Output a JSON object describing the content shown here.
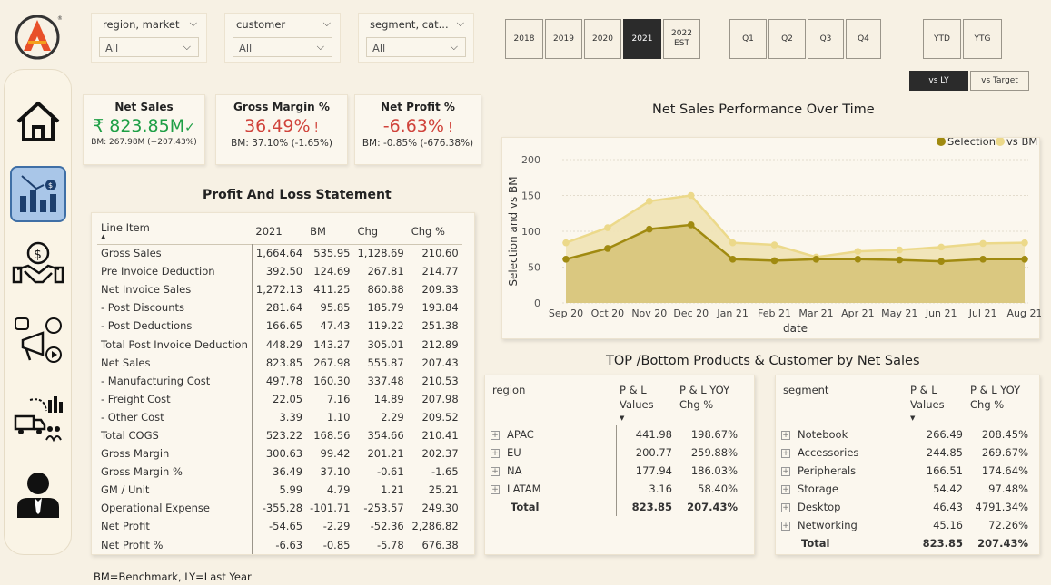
{
  "filters": [
    {
      "label": "region, market",
      "value": "All"
    },
    {
      "label": "customer",
      "value": "All"
    },
    {
      "label": "segment, cat...",
      "value": "All"
    }
  ],
  "years": [
    "2018",
    "2019",
    "2020",
    "2021",
    "2022\nEST"
  ],
  "selected_year": "2021",
  "quarters": [
    "Q1",
    "Q2",
    "Q3",
    "Q4"
  ],
  "periods": [
    "YTD",
    "YTG"
  ],
  "comparisons": [
    "vs LY",
    "vs Target"
  ],
  "selected_comparison": "vs LY",
  "colors": {
    "accent_dark": "#a08a10",
    "accent_light": "#ecd98a",
    "positive": "#1e9f45",
    "negative": "#d0433b"
  },
  "kpis": {
    "net_sales": {
      "title": "Net Sales",
      "value": "₹ 823.85M",
      "icon": "check-icon",
      "sub": "BM: 267.98M (+207.43%)"
    },
    "gross_margin": {
      "title": "Gross Margin %",
      "value": "36.49%",
      "icon": "exclamation-icon",
      "sub": "BM: 37.10% (-1.65%)"
    },
    "net_profit": {
      "title": "Net Profit %",
      "value": "-6.63%",
      "icon": "exclamation-icon",
      "sub": "BM: -0.85% (-676.38%)"
    }
  },
  "pl": {
    "title": "Profit And Loss Statement",
    "columns": [
      "Line Item",
      "2021",
      "BM",
      "Chg",
      "Chg %"
    ],
    "rows": [
      [
        "Gross Sales",
        "1,664.64",
        "535.95",
        "1,128.69",
        "210.60"
      ],
      [
        "Pre Invoice Deduction",
        "392.50",
        "124.69",
        "267.81",
        "214.77"
      ],
      [
        "Net Invoice Sales",
        "1,272.13",
        "411.25",
        "860.88",
        "209.33"
      ],
      [
        "- Post Discounts",
        "281.64",
        "95.85",
        "185.79",
        "193.84"
      ],
      [
        "- Post Deductions",
        "166.65",
        "47.43",
        "119.22",
        "251.38"
      ],
      [
        "Total Post Invoice Deduction",
        "448.29",
        "143.27",
        "305.01",
        "212.89"
      ],
      [
        "Net Sales",
        "823.85",
        "267.98",
        "555.87",
        "207.43"
      ],
      [
        "- Manufacturing Cost",
        "497.78",
        "160.30",
        "337.48",
        "210.53"
      ],
      [
        "- Freight Cost",
        "22.05",
        "7.16",
        "14.89",
        "207.98"
      ],
      [
        "- Other Cost",
        "3.39",
        "1.10",
        "2.29",
        "209.52"
      ],
      [
        "Total COGS",
        "523.22",
        "168.56",
        "354.66",
        "210.41"
      ],
      [
        "Gross Margin",
        "300.63",
        "99.42",
        "201.21",
        "202.37"
      ],
      [
        "Gross Margin %",
        "36.49",
        "37.10",
        "-0.61",
        "-1.65"
      ],
      [
        "GM / Unit",
        "5.99",
        "4.79",
        "1.21",
        "25.21"
      ],
      [
        "Operational Expense",
        "-355.28",
        "-101.71",
        "-253.57",
        "249.30"
      ],
      [
        "Net Profit",
        "-54.65",
        "-2.29",
        "-52.36",
        "2,286.82"
      ],
      [
        "Net Profit %",
        "-6.63",
        "-0.85",
        "-5.78",
        "676.38"
      ]
    ]
  },
  "chart_data": {
    "type": "area",
    "title": "Net Sales Performance Over Time",
    "xlabel": "date",
    "ylabel": "Selection and vs BM",
    "categories": [
      "Sep 20",
      "Oct 20",
      "Nov 20",
      "Dec 20",
      "Jan 21",
      "Feb 21",
      "Mar 21",
      "Apr 21",
      "May 21",
      "Jun 21",
      "Jul 21",
      "Aug 21"
    ],
    "ylim": [
      0,
      200
    ],
    "yticks": [
      0,
      50,
      100,
      150,
      200
    ],
    "legend_position": "top-right",
    "series": [
      {
        "name": "Selection",
        "values": [
          61,
          76,
          103,
          109,
          61,
          59,
          61,
          61,
          60,
          58,
          61,
          61
        ]
      },
      {
        "name": "vs BM",
        "values": [
          84,
          105,
          142,
          150,
          84,
          81,
          64,
          72,
          74,
          78,
          83,
          84
        ]
      }
    ]
  },
  "top_bottom": {
    "title": "TOP /Bottom Products & Customer by Net Sales",
    "region": {
      "columns": [
        "region",
        "P & L Values",
        "P & L YOY Chg %"
      ],
      "rows": [
        [
          "APAC",
          "441.98",
          "198.67%"
        ],
        [
          "EU",
          "200.77",
          "259.88%"
        ],
        [
          "NA",
          "177.94",
          "186.03%"
        ],
        [
          "LATAM",
          "3.16",
          "58.40%"
        ]
      ],
      "total": [
        "Total",
        "823.85",
        "207.43%"
      ]
    },
    "segment": {
      "columns": [
        "segment",
        "P & L Values",
        "P & L YOY Chg %"
      ],
      "rows": [
        [
          "Notebook",
          "266.49",
          "208.45%"
        ],
        [
          "Accessories",
          "244.85",
          "269.67%"
        ],
        [
          "Peripherals",
          "166.51",
          "174.64%"
        ],
        [
          "Storage",
          "54.42",
          "97.48%"
        ],
        [
          "Desktop",
          "46.43",
          "4791.34%"
        ],
        [
          "Networking",
          "45.16",
          "72.26%"
        ]
      ],
      "total": [
        "Total",
        "823.85",
        "207.43%"
      ]
    }
  },
  "nav_icons": [
    "home-icon",
    "finance-chart-icon",
    "handshake-money-icon",
    "marketing-icon",
    "supply-chain-icon",
    "executive-icon"
  ],
  "footnote": "BM=Benchmark, LY=Last Year"
}
